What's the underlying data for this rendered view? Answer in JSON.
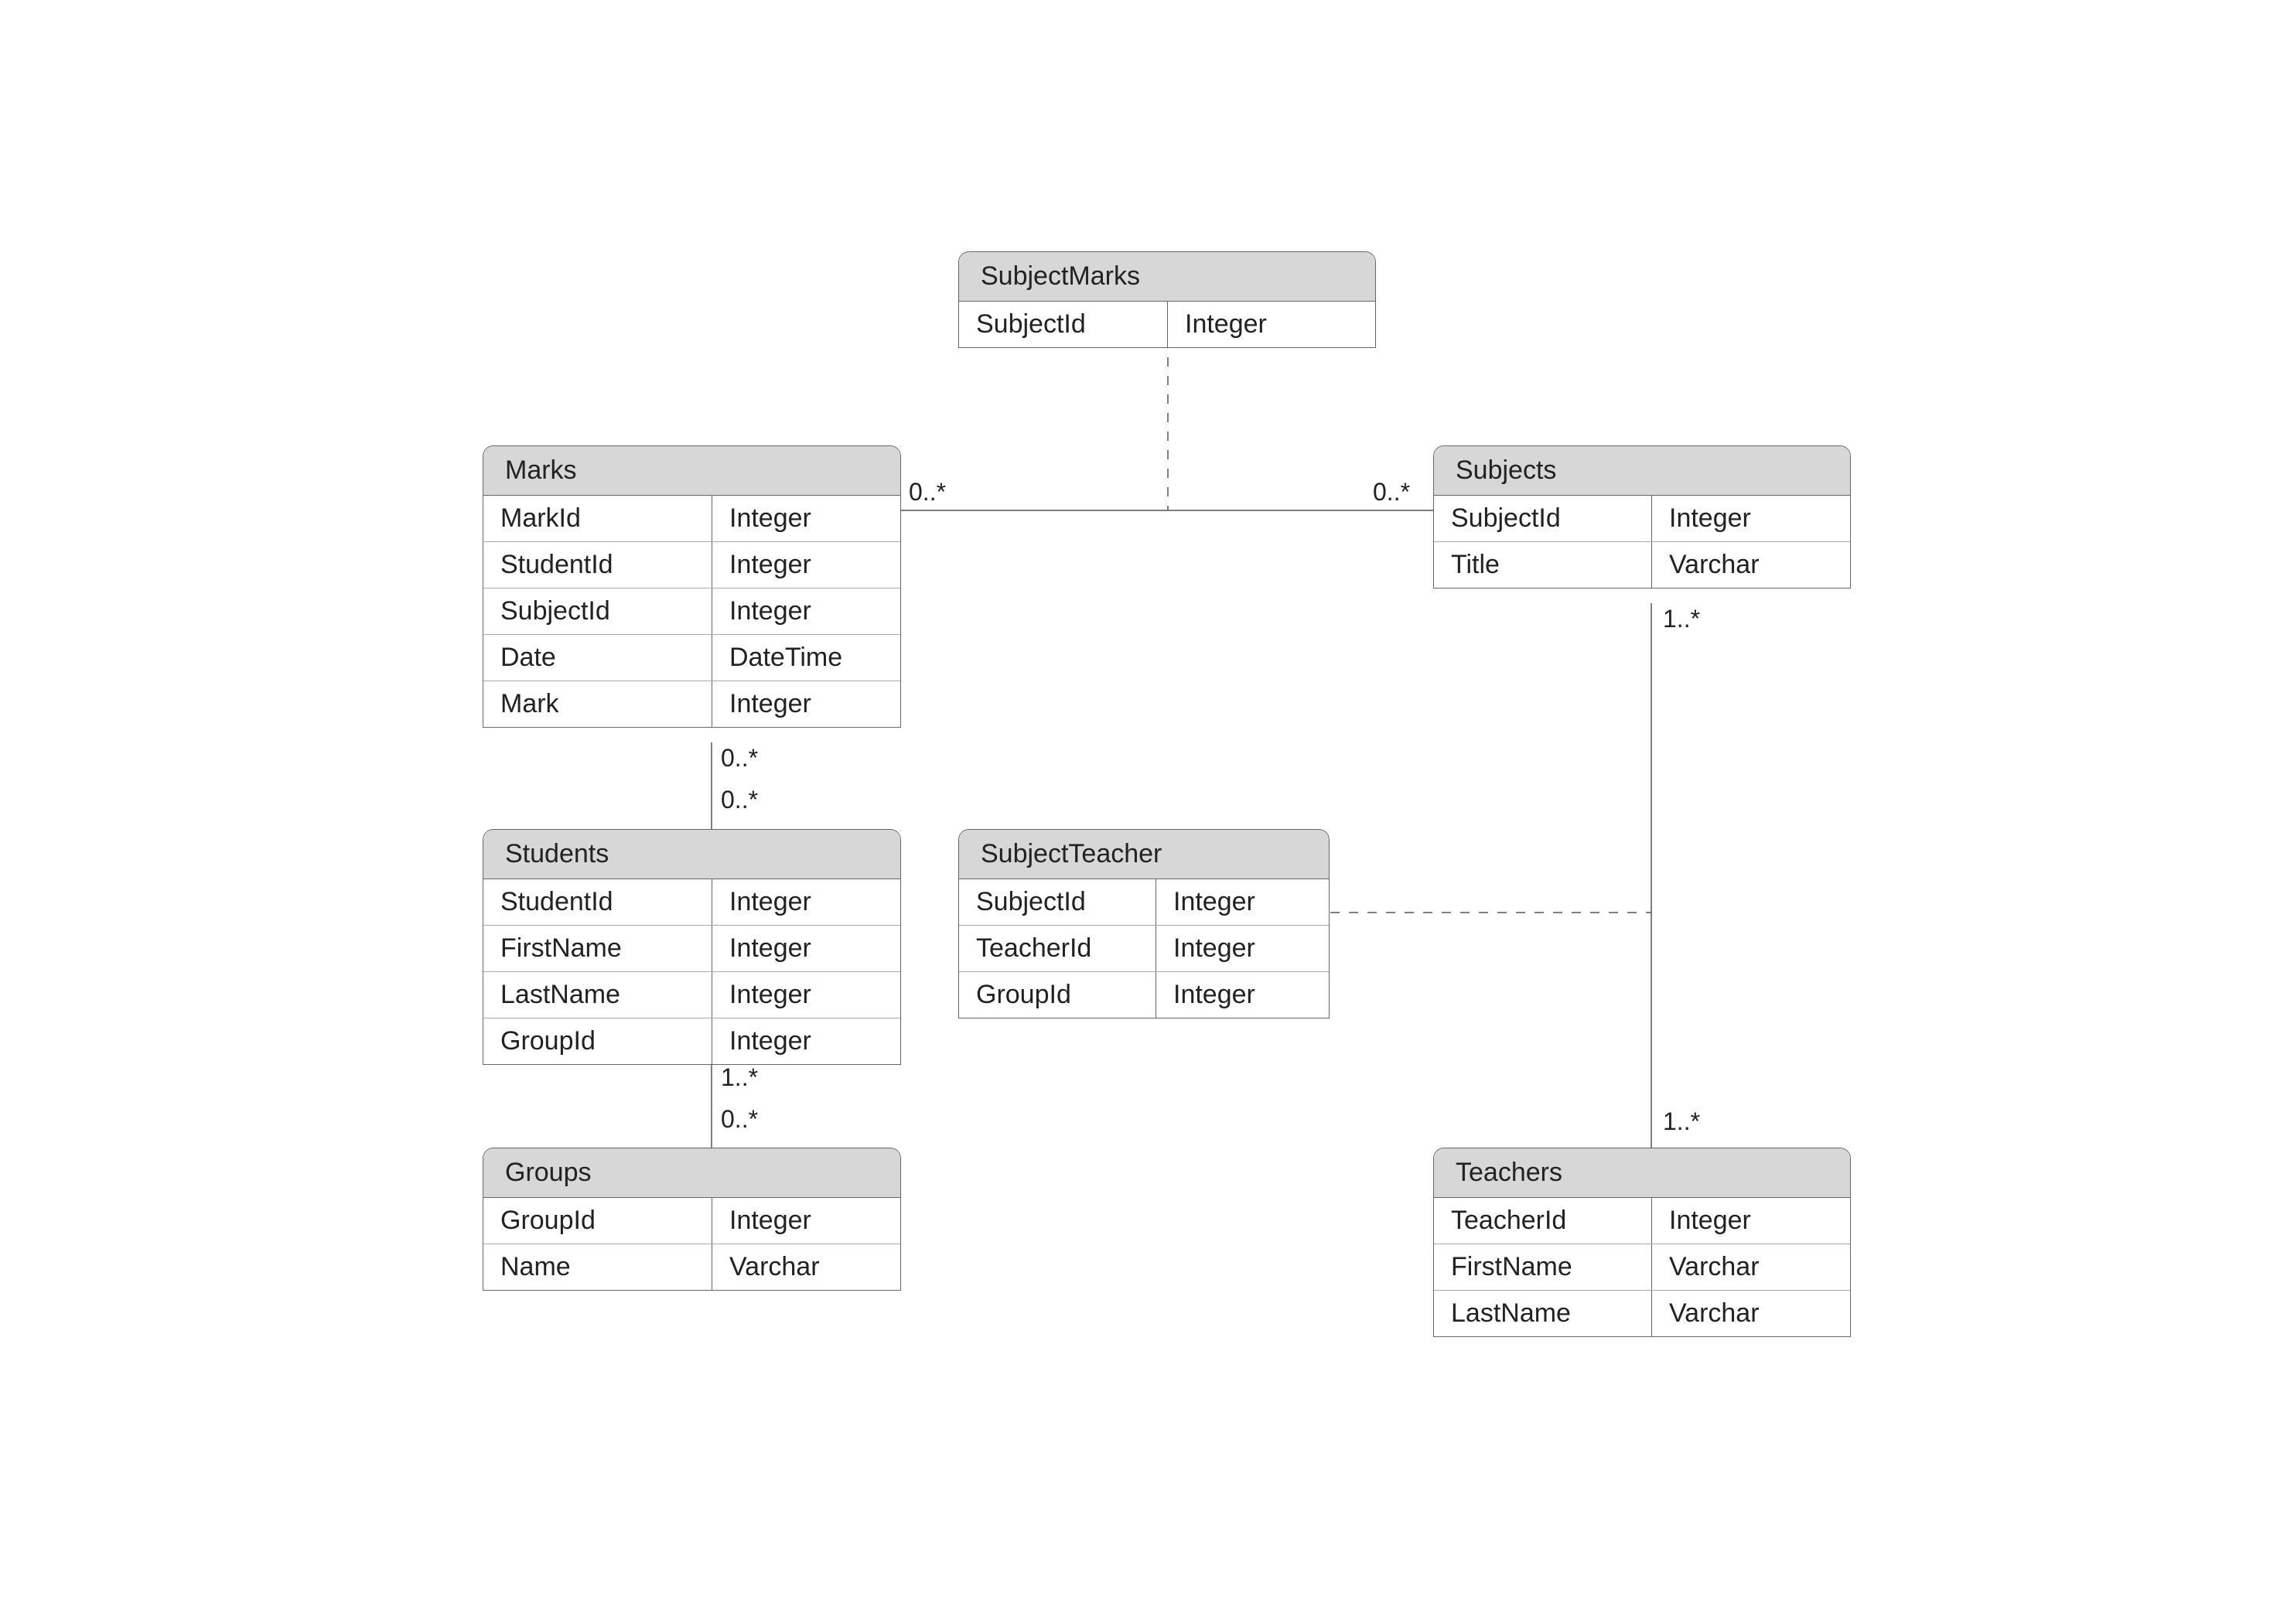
{
  "entities": {
    "subjectMarks": {
      "title": "SubjectMarks",
      "rows": [
        {
          "name": "SubjectId",
          "type": "Integer"
        }
      ]
    },
    "marks": {
      "title": "Marks",
      "rows": [
        {
          "name": "MarkId",
          "type": "Integer"
        },
        {
          "name": "StudentId",
          "type": "Integer"
        },
        {
          "name": "SubjectId",
          "type": "Integer"
        },
        {
          "name": "Date",
          "type": "DateTime"
        },
        {
          "name": "Mark",
          "type": "Integer"
        }
      ]
    },
    "subjects": {
      "title": "Subjects",
      "rows": [
        {
          "name": "SubjectId",
          "type": "Integer"
        },
        {
          "name": "Title",
          "type": "Varchar"
        }
      ]
    },
    "students": {
      "title": "Students",
      "rows": [
        {
          "name": "StudentId",
          "type": "Integer"
        },
        {
          "name": "FirstName",
          "type": "Integer"
        },
        {
          "name": "LastName",
          "type": "Integer"
        },
        {
          "name": "GroupId",
          "type": "Integer"
        }
      ]
    },
    "subjectTeacher": {
      "title": "SubjectTeacher",
      "rows": [
        {
          "name": "SubjectId",
          "type": "Integer"
        },
        {
          "name": "TeacherId",
          "type": "Integer"
        },
        {
          "name": "GroupId",
          "type": "Integer"
        }
      ]
    },
    "groups": {
      "title": "Groups",
      "rows": [
        {
          "name": "GroupId",
          "type": "Integer"
        },
        {
          "name": "Name",
          "type": "Varchar"
        }
      ]
    },
    "teachers": {
      "title": "Teachers",
      "rows": [
        {
          "name": "TeacherId",
          "type": "Integer"
        },
        {
          "name": "FirstName",
          "type": "Varchar"
        },
        {
          "name": "LastName",
          "type": "Varchar"
        }
      ]
    }
  },
  "labels": {
    "marksSubjects_left": "0..*",
    "marksSubjects_right": "0..*",
    "marksStudents_top": "0..*",
    "marksStudents_bottom": "0..*",
    "studentsGroups_top": "1..*",
    "studentsGroups_bottom": "0..*",
    "subjectsTeachers_top": "1..*",
    "subjectsTeachers_bottom": "1..*"
  }
}
